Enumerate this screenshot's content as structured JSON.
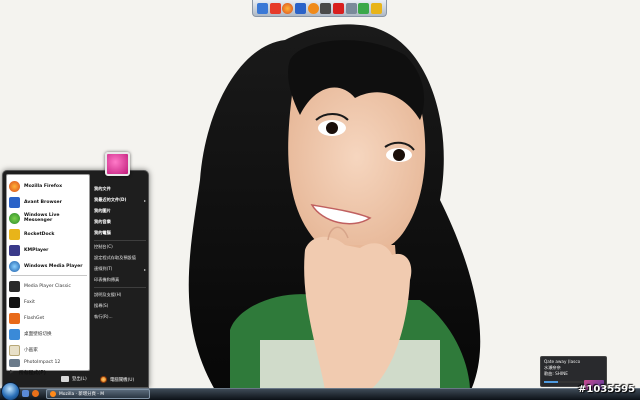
{
  "dock": {
    "icons": [
      "finder-icon",
      "notes-icon",
      "firefox-icon",
      "avant-icon",
      "browser-icon",
      "tool-icon",
      "acrobat-icon",
      "gadget-icon",
      "photo-icon",
      "rocket-icon"
    ]
  },
  "start_menu": {
    "pinned": [
      {
        "label": "Mozilla Firefox",
        "icon": "firefox-icon"
      },
      {
        "label": "Avant Browser",
        "icon": "avant-browser-icon"
      },
      {
        "label": "Windows Live Messenger",
        "icon": "messenger-icon"
      },
      {
        "label": "RocketDock",
        "icon": "rocketdock-icon"
      },
      {
        "label": "KMPlayer",
        "icon": "kmplayer-icon"
      },
      {
        "label": "Windows Media Player",
        "icon": "media-player-icon"
      }
    ],
    "recent": [
      {
        "label": "Media Player Classic",
        "icon": "mpc-icon"
      },
      {
        "label": "Foxit",
        "icon": "foxit-icon"
      },
      {
        "label": "FlashGet",
        "icon": "flashget-icon"
      },
      {
        "label": "桌面壁纸切换",
        "icon": "wallpaper-icon"
      },
      {
        "label": "小画家",
        "icon": "paint-icon"
      },
      {
        "label": "PhotoImpact 12",
        "icon": "photoimpact-icon"
      }
    ],
    "all_programs": "所有程式(P)",
    "places": [
      {
        "label": "我的文件",
        "bold": true
      },
      {
        "label": "我最近的文件(D)",
        "bold": true,
        "arrow": true
      },
      {
        "label": "我的圖片",
        "bold": true
      },
      {
        "label": "我的音樂",
        "bold": true
      },
      {
        "label": "我的電腦",
        "bold": true
      },
      {
        "label": "控制台(C)",
        "bold": false
      },
      {
        "label": "設定程式存取及預設值",
        "bold": false
      },
      {
        "label": "連線到(T)",
        "bold": false,
        "arrow": true
      },
      {
        "label": "印表機和傳真",
        "bold": false
      },
      {
        "label": "說明及支援(H)",
        "bold": false
      },
      {
        "label": "搜尋(S)",
        "bold": false
      },
      {
        "label": "執行(R)...",
        "bold": false
      }
    ],
    "logoff_label": "登出(L)",
    "shutdown_label": "電腦關機(U)"
  },
  "taskbar": {
    "task_label": "Mozilla · 新增分頁 - M"
  },
  "gadget": {
    "line1": "Qate away (lasco",
    "line2": "水瀬奈奈",
    "line3": "歌曲: SHINE",
    "progress": 0.35
  },
  "watermark": "#1035595",
  "colors": {
    "start_menu_bg": "#1e1e1e",
    "taskbar_top": "#3e4a56",
    "accent_pink": "#e02a8a"
  }
}
